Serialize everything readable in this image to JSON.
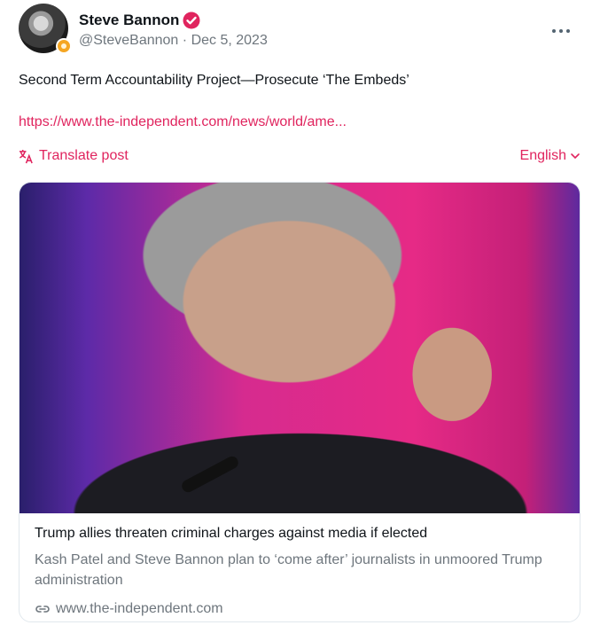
{
  "author": {
    "display_name": "Steve Bannon",
    "handle": "@SteveBannon",
    "separator": "·",
    "date": "Dec 5, 2023"
  },
  "post": {
    "text": "Second Term Accountability Project—Prosecute ‘The Embeds’",
    "link": "https://www.the-independent.com/news/world/ame...",
    "translate_label": "Translate post",
    "language": "English"
  },
  "card": {
    "title": "Trump allies threaten criminal charges against media if elected",
    "description": "Kash Patel and Steve Bannon plan to ‘come after’ journalists in unmoored Trump administration",
    "domain": "www.the-independent.com"
  },
  "colors": {
    "accent": "#e0245e",
    "verified": "#e0245e",
    "muted": "#6e767d"
  }
}
